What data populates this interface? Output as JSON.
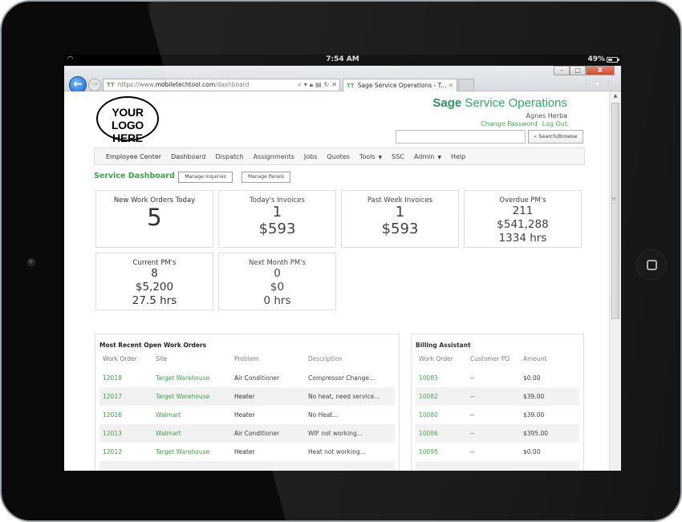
{
  "device": {
    "status_bar": {
      "time": "7:54 AM",
      "battery": "49%"
    }
  },
  "browser": {
    "url_prefix": "https://www.",
    "url_host": "mobiletechtool.com",
    "url_path": "/dashboard",
    "favicon_text": "TT",
    "tab_title": "Sage Service Operations - T...",
    "window_controls": {
      "minimize": "–",
      "maximize": "□",
      "close": "X"
    }
  },
  "header": {
    "logo_line1": "YOUR",
    "logo_line2": "LOGO HERE",
    "brand_bold": "Sage",
    "brand_rest": " Service Operations",
    "user_name": "Agnes Herba",
    "change_password": "Change Password",
    "log_out": "Log Out",
    "search_placeholder": "",
    "search_button": "Search/Browse"
  },
  "nav": {
    "items": [
      {
        "label": "Employee Center"
      },
      {
        "label": "Dashboard"
      },
      {
        "label": "Dispatch"
      },
      {
        "label": "Assignments"
      },
      {
        "label": "Jobs"
      },
      {
        "label": "Quotes"
      },
      {
        "label": "Tools",
        "dropdown": true
      },
      {
        "label": "SSC"
      },
      {
        "label": "Admin",
        "dropdown": true
      },
      {
        "label": "Help"
      }
    ]
  },
  "dashboard": {
    "title": "Service Dashboard",
    "manage_inquiries": "Manage Inquiries",
    "manage_panels": "Manage Panels",
    "cards": {
      "new_work_orders": {
        "title": "New Work Orders Today",
        "value": "5"
      },
      "todays_invoices": {
        "title": "Today's Invoices",
        "count": "1",
        "amount": "$593"
      },
      "past_week_invoices": {
        "title": "Past Week Invoices",
        "count": "1",
        "amount": "$593"
      },
      "overdue_pms": {
        "title": "Overdue PM's",
        "count": "211",
        "amount": "$541,288",
        "hours": "1334 hrs"
      },
      "current_pms": {
        "title": "Current PM's",
        "count": "8",
        "amount": "$5,200",
        "hours": "27.5 hrs"
      },
      "next_month_pms": {
        "title": "Next Month PM's",
        "count": "0",
        "amount": "$0",
        "hours": "0 hrs"
      }
    }
  },
  "work_orders": {
    "title": "Most Recent Open Work Orders",
    "columns": [
      "Work Order",
      "Site",
      "Problem",
      "Description"
    ],
    "rows": [
      {
        "work_order": "12018",
        "site": "Target Warehouse",
        "problem": "Air Conditioner",
        "description": "Compressor Change..."
      },
      {
        "work_order": "12017",
        "site": "Target Warehouse",
        "problem": "Heater",
        "description": "No heat, need service..."
      },
      {
        "work_order": "12016",
        "site": "Walmart",
        "problem": "Heater",
        "description": "No Heat..."
      },
      {
        "work_order": "12013",
        "site": "Walmart",
        "problem": "Air Conditioner",
        "description": "WIF not working..."
      },
      {
        "work_order": "12012",
        "site": "Target Warehouse",
        "problem": "Heater",
        "description": "Heat not working..."
      }
    ]
  },
  "billing": {
    "title": "Billing Assistant",
    "columns": [
      "Work Order",
      "Customer PO",
      "Amount"
    ],
    "rows": [
      {
        "work_order": "10083",
        "po": "--",
        "amount": "$0.00"
      },
      {
        "work_order": "10082",
        "po": "--",
        "amount": "$39.00"
      },
      {
        "work_order": "10080",
        "po": "--",
        "amount": "$39.00"
      },
      {
        "work_order": "10086",
        "po": "--",
        "amount": "$395.00"
      },
      {
        "work_order": "10095",
        "po": "--",
        "amount": "$0.00"
      }
    ]
  }
}
